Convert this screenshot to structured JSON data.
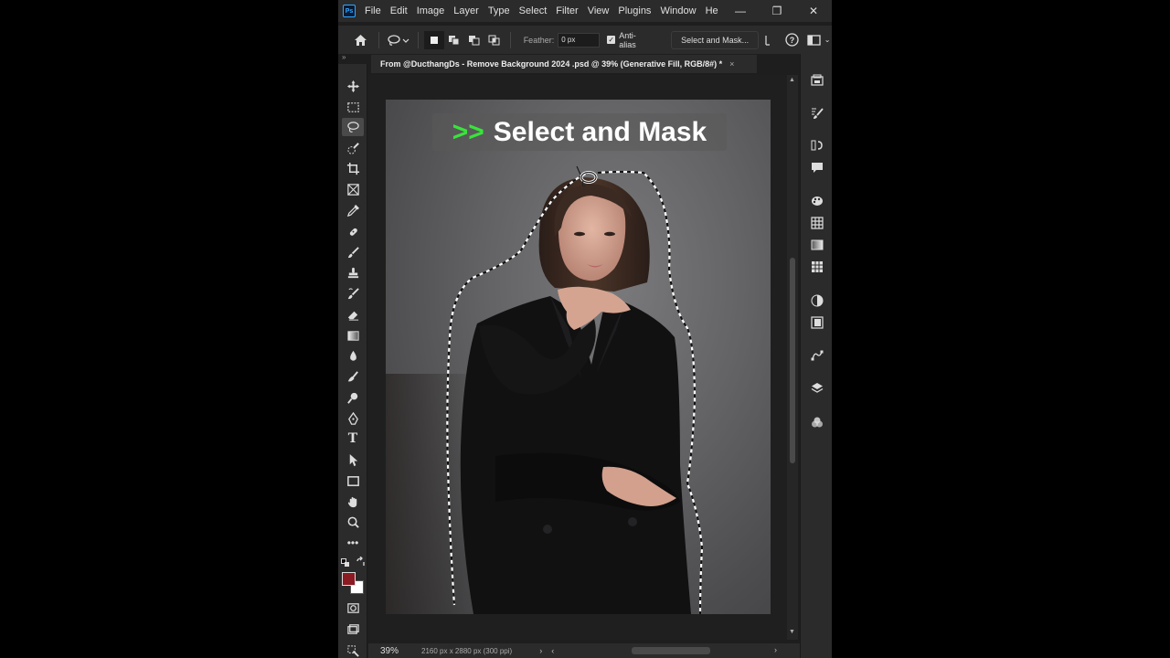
{
  "app": {
    "logo": "Ps",
    "menu": [
      "File",
      "Edit",
      "Image",
      "Layer",
      "Type",
      "Select",
      "Filter",
      "View",
      "Plugins",
      "Window",
      "He"
    ],
    "window_controls": {
      "minimize": "—",
      "restore": "❐",
      "close": "✕"
    }
  },
  "options": {
    "feather_label": "Feather:",
    "feather_value": "0 px",
    "antialias_label": "Anti-alias",
    "antialias_checked": true,
    "select_and_mask_label": "Select and Mask..."
  },
  "document": {
    "tab_title": "From @DucthangDs - Remove Background 2024 .psd @ 39% (Generative Fill, RGB/8#) *",
    "close": "×"
  },
  "overlay": {
    "arrow": ">>",
    "text": "Select and Mask",
    "arrow_color": "#38e43a"
  },
  "status": {
    "zoom": "39%",
    "doc_size": "2160 px x 2880 px (300 ppi)",
    "arrow": "›",
    "scroll_left": "‹",
    "scroll_right": "›"
  },
  "colors": {
    "foreground": "#8b1a22",
    "background": "#ffffff",
    "accent": "#31a8ff"
  },
  "tools": [
    "move-tool",
    "marquee-tool",
    "lasso-tool",
    "quick-selection-tool",
    "crop-tool",
    "frame-tool",
    "eyedropper-tool",
    "healing-brush-tool",
    "brush-tool",
    "clone-stamp-tool",
    "history-brush-tool",
    "eraser-tool",
    "gradient-tool",
    "blur-tool",
    "dodge-tool",
    "burn-tool",
    "pen-tool",
    "type-tool",
    "path-selection-tool",
    "rectangle-tool",
    "hand-tool",
    "zoom-tool",
    "more-tools"
  ],
  "panels": [
    "libraries-panel",
    "brush-settings-panel",
    "properties-panel",
    "comments-panel",
    "color-panel",
    "swatches-panel",
    "gradients-panel",
    "patterns-panel",
    "adjustments-panel",
    "styles-panel",
    "paths-panel",
    "layers-panel",
    "channels-panel"
  ]
}
